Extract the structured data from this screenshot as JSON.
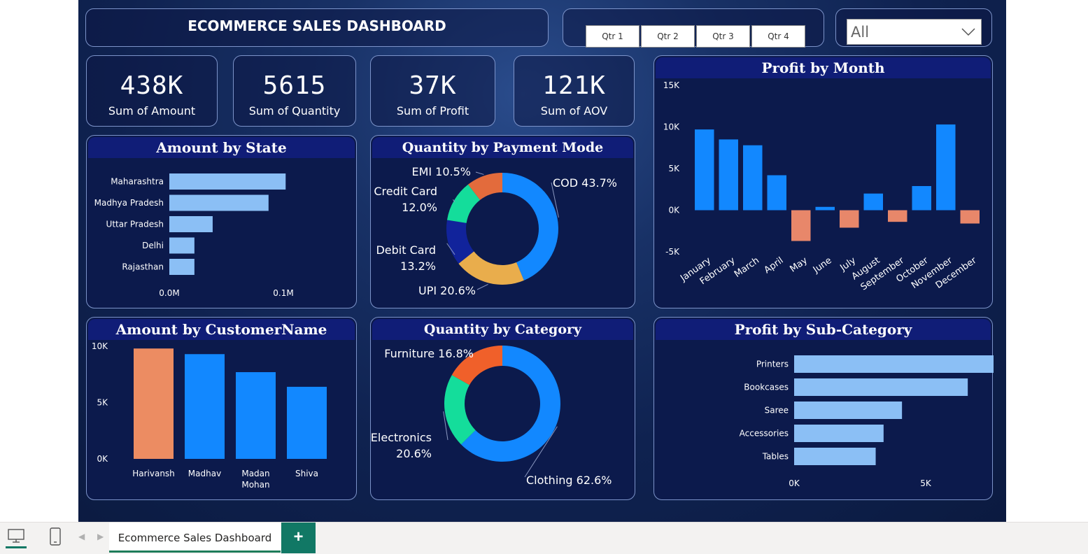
{
  "header": {
    "title": "ECOMMERCE SALES DASHBOARD",
    "quarters": [
      "Qtr 1",
      "Qtr 2",
      "Qtr 3",
      "Qtr 4"
    ],
    "filter": {
      "selected": "All"
    }
  },
  "kpis": [
    {
      "value": "438K",
      "label": "Sum of Amount"
    },
    {
      "value": "5615",
      "label": "Sum of Quantity"
    },
    {
      "value": "37K",
      "label": "Sum of Profit"
    },
    {
      "value": "121K",
      "label": "Sum of AOV"
    }
  ],
  "colors": {
    "bar": "#1288ff",
    "light_bar": "#8bbff5",
    "negative": "#e8876a",
    "highlight": "#ec8c62"
  },
  "chart_data": [
    {
      "id": "amount_by_state",
      "type": "bar",
      "orientation": "horizontal",
      "title": "Amount by State",
      "categories": [
        "Maharashtra",
        "Madhya Pradesh",
        "Uttar Pradesh",
        "Delhi",
        "Rajasthan"
      ],
      "values": [
        0.102,
        0.087,
        0.038,
        0.022,
        0.022
      ],
      "xlim": [
        0,
        0.1
      ],
      "xticks": [
        "0.0M",
        "0.1M"
      ],
      "grid": false
    },
    {
      "id": "quantity_by_payment_mode",
      "type": "pie",
      "donut": true,
      "title": "Quantity by Payment Mode",
      "slices": [
        {
          "label": "COD",
          "value": 43.7,
          "display": "COD 43.7%",
          "color": "#1288ff"
        },
        {
          "label": "UPI",
          "value": 20.6,
          "display": "UPI 20.6%",
          "color": "#e9ad4c"
        },
        {
          "label": "Debit Card",
          "value": 13.2,
          "display": "Debit Card\n13.2%",
          "color": "#11239b"
        },
        {
          "label": "Credit Card",
          "value": 12.0,
          "display": "Credit Card\n12.0%",
          "color": "#14dd9b"
        },
        {
          "label": "EMI",
          "value": 10.5,
          "display": "EMI 10.5%",
          "color": "#e36b3c"
        }
      ]
    },
    {
      "id": "profit_by_month",
      "type": "bar",
      "title": "Profit by Month",
      "categories": [
        "January",
        "February",
        "March",
        "April",
        "May",
        "June",
        "July",
        "August",
        "September",
        "October",
        "November",
        "December"
      ],
      "values": [
        9700,
        8500,
        7800,
        4200,
        -3700,
        400,
        -2100,
        2000,
        -1400,
        2900,
        10300,
        -1600
      ],
      "ylim": [
        -5000,
        15000
      ],
      "yticks": [
        "15K",
        "10K",
        "5K",
        "0K",
        "-5K"
      ],
      "positive_color": "#1288ff",
      "negative_color": "#e8876a",
      "grid": false
    },
    {
      "id": "amount_by_customer",
      "type": "bar",
      "title": "Amount by CustomerName",
      "categories": [
        "Harivansh",
        "Madhav",
        "Madan Mohan",
        "Shiva"
      ],
      "values": [
        9800,
        9300,
        7700,
        6400
      ],
      "highlight_index": 0,
      "ylim": [
        0,
        10000
      ],
      "yticks": [
        "10K",
        "5K",
        "0K"
      ],
      "grid": false
    },
    {
      "id": "quantity_by_category",
      "type": "pie",
      "donut": true,
      "title": "Quantity by Category",
      "slices": [
        {
          "label": "Clothing",
          "value": 62.6,
          "display": "Clothing 62.6%",
          "color": "#1288ff"
        },
        {
          "label": "Electronics",
          "value": 20.6,
          "display": "Electronics\n20.6%",
          "color": "#14dd9b"
        },
        {
          "label": "Furniture",
          "value": 16.8,
          "display": "Furniture 16.8%",
          "color": "#f0602a"
        }
      ]
    },
    {
      "id": "profit_by_subcategory",
      "type": "bar",
      "orientation": "horizontal",
      "title": "Profit by Sub-Category",
      "categories": [
        "Printers",
        "Bookcases",
        "Saree",
        "Accessories",
        "Tables"
      ],
      "values": [
        8600,
        6600,
        4100,
        3400,
        3100
      ],
      "xlim": [
        0,
        10000
      ],
      "xticks": [
        "0K",
        "5K",
        "10K"
      ],
      "grid": false
    }
  ],
  "footer": {
    "page_tab": "Ecommerce Sales Dashboard",
    "add_label": "+"
  }
}
